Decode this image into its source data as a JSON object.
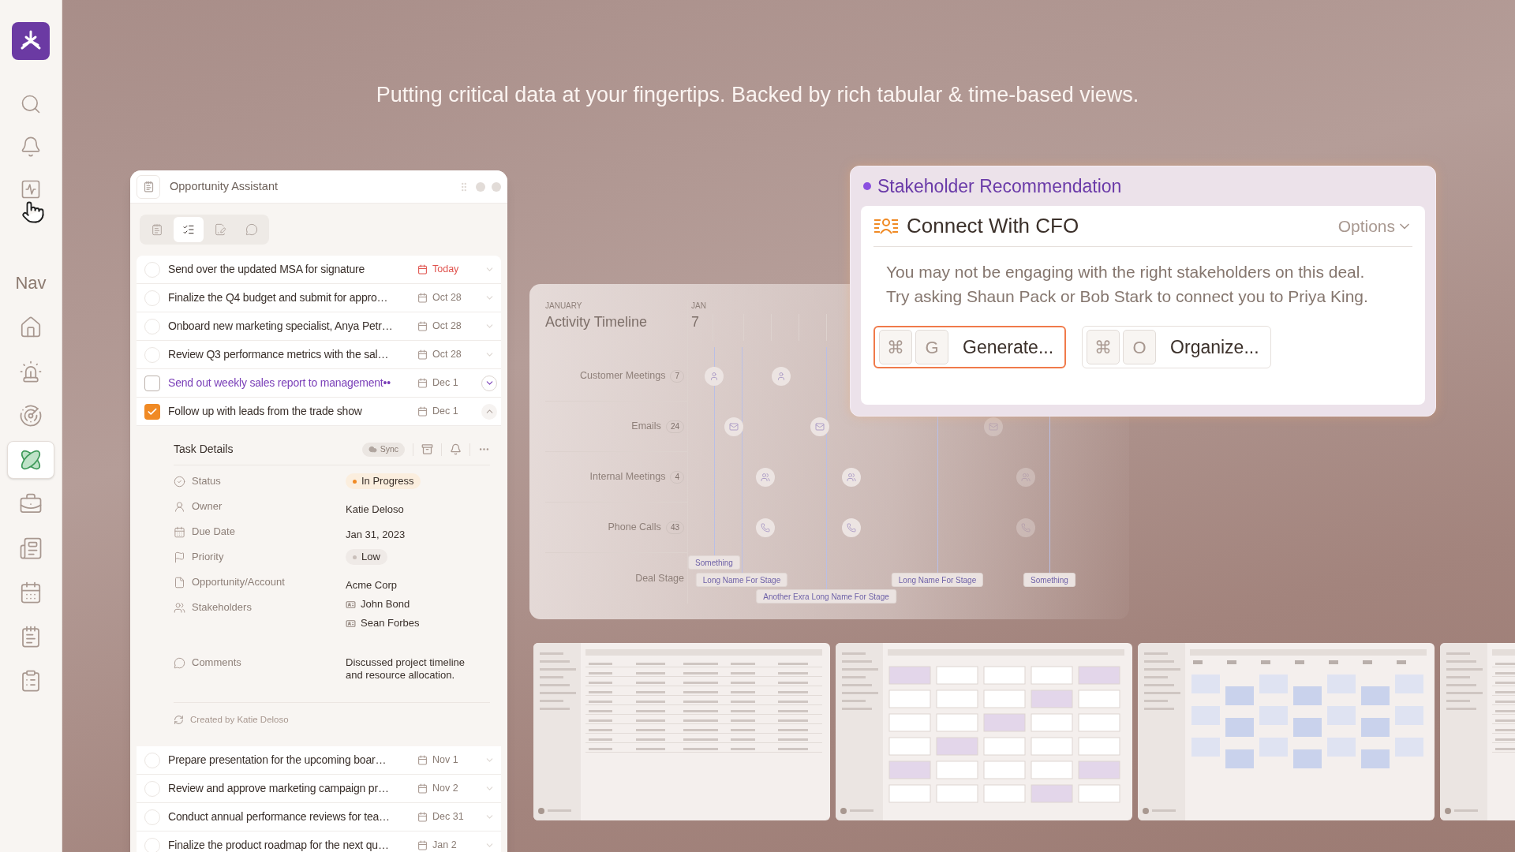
{
  "sidebar": {
    "top_items": [
      {
        "kind": "search"
      },
      {
        "kind": "bell"
      },
      {
        "kind": "activity"
      }
    ],
    "section_title": "Nav",
    "nav_items": [
      {
        "kind": "home",
        "selected": false
      },
      {
        "kind": "alarm",
        "selected": false
      },
      {
        "kind": "radar",
        "selected": false
      },
      {
        "kind": "atom",
        "selected": true
      },
      {
        "kind": "briefcase",
        "selected": false
      },
      {
        "kind": "newspaper",
        "selected": false
      },
      {
        "kind": "calendar",
        "selected": false
      },
      {
        "kind": "notepad",
        "selected": false
      },
      {
        "kind": "checklist",
        "selected": false
      }
    ]
  },
  "headline": "Putting critical data at your fingertips. Backed by rich tabular & time-based views.",
  "assistant": {
    "title": "Opportunity Assistant",
    "tabs": [
      {
        "kind": "notes",
        "selected": false
      },
      {
        "kind": "checklist",
        "selected": true
      },
      {
        "kind": "edit",
        "selected": false
      },
      {
        "kind": "chat",
        "selected": false
      }
    ],
    "tasks": [
      {
        "title": "Send over the updated MSA for signature",
        "date": "Today",
        "due_today": true,
        "checked": false,
        "hovered": false,
        "expanded": false
      },
      {
        "title": "Finalize the Q4 budget and submit for appro…",
        "date": "Oct 28",
        "due_today": false,
        "checked": false,
        "hovered": false,
        "expanded": false
      },
      {
        "title": "Onboard new marketing specialist, Anya Petr…",
        "date": "Oct 28",
        "due_today": false,
        "checked": false,
        "hovered": false,
        "expanded": false
      },
      {
        "title": "Review Q3 performance metrics with the sal…",
        "date": "Oct 28",
        "due_today": false,
        "checked": false,
        "hovered": false,
        "expanded": false
      },
      {
        "title": "Send out weekly sales report to management••",
        "date": "Dec 1",
        "due_today": false,
        "checked": false,
        "hovered": true,
        "expanded": false
      },
      {
        "title": "Follow up with leads from the trade show",
        "date": "Dec 1",
        "due_today": false,
        "checked": true,
        "hovered": false,
        "expanded": true,
        "details": {
          "title": "Task Details",
          "sync": "Sync",
          "fields": [
            {
              "kind": "status",
              "label": "Status",
              "value": "In Progress",
              "color": "#f08a24"
            },
            {
              "kind": "owner",
              "label": "Owner",
              "value": "Katie Deloso"
            },
            {
              "kind": "due_date",
              "label": "Due Date",
              "value": "Jan 31, 2023"
            },
            {
              "kind": "priority",
              "label": "Priority",
              "value": "Low",
              "color": "#c9bfba"
            },
            {
              "kind": "opportunity",
              "label": "Opportunity/Account",
              "value": "Acme Corp"
            },
            {
              "kind": "stakeholders",
              "label": "Stakeholders",
              "values": [
                "John Bond",
                "Sean Forbes"
              ]
            },
            {
              "kind": "comments",
              "label": "Comments",
              "value": "Discussed project timeline and resource allocation."
            }
          ],
          "created_by": "Created by Katie Deloso"
        }
      },
      {
        "title": "Prepare presentation for the upcoming boar…",
        "date": "Nov 1",
        "due_today": false,
        "checked": false,
        "hovered": false,
        "expanded": false
      },
      {
        "title": "Review and approve marketing campaign pr…",
        "date": "Nov 2",
        "due_today": false,
        "checked": false,
        "hovered": false,
        "expanded": false
      },
      {
        "title": "Conduct annual performance reviews for tea…",
        "date": "Dec 31",
        "due_today": false,
        "checked": false,
        "hovered": false,
        "expanded": false
      },
      {
        "title": "Finalize the product roadmap for the next qu…",
        "date": "Jan 2",
        "due_today": false,
        "checked": false,
        "hovered": false,
        "expanded": false
      }
    ]
  },
  "timeline": {
    "month": "JANUARY",
    "title": "Activity Timeline",
    "day_month": "JAN",
    "day": "7",
    "rows": [
      {
        "kind": "meetings",
        "label": "Customer Meetings",
        "count": "7"
      },
      {
        "kind": "emails",
        "label": "Emails",
        "count": "24"
      },
      {
        "kind": "internal",
        "label": "Internal Meetings",
        "count": "4"
      },
      {
        "kind": "calls",
        "label": "Phone Calls",
        "count": "43"
      }
    ],
    "stage_row": "Deal Stage",
    "stages": [
      "Something",
      "Long Name For Stage",
      "Another Exra Long Name For Stage",
      "Long Name For Stage",
      "Something"
    ]
  },
  "recommendation": {
    "heading": "Stakeholder Recommendation",
    "title": "Connect With CFO",
    "options": "Options",
    "body": "You may not be engaging with the right stakeholders on this deal. Try asking Shaun Pack or Bob Stark to connect you to Priya King.",
    "actions": [
      {
        "keys": [
          "⌘",
          "G"
        ],
        "label": "Generate...",
        "selected": true
      },
      {
        "keys": [
          "⌘",
          "O"
        ],
        "label": "Organize...",
        "selected": false
      }
    ]
  }
}
